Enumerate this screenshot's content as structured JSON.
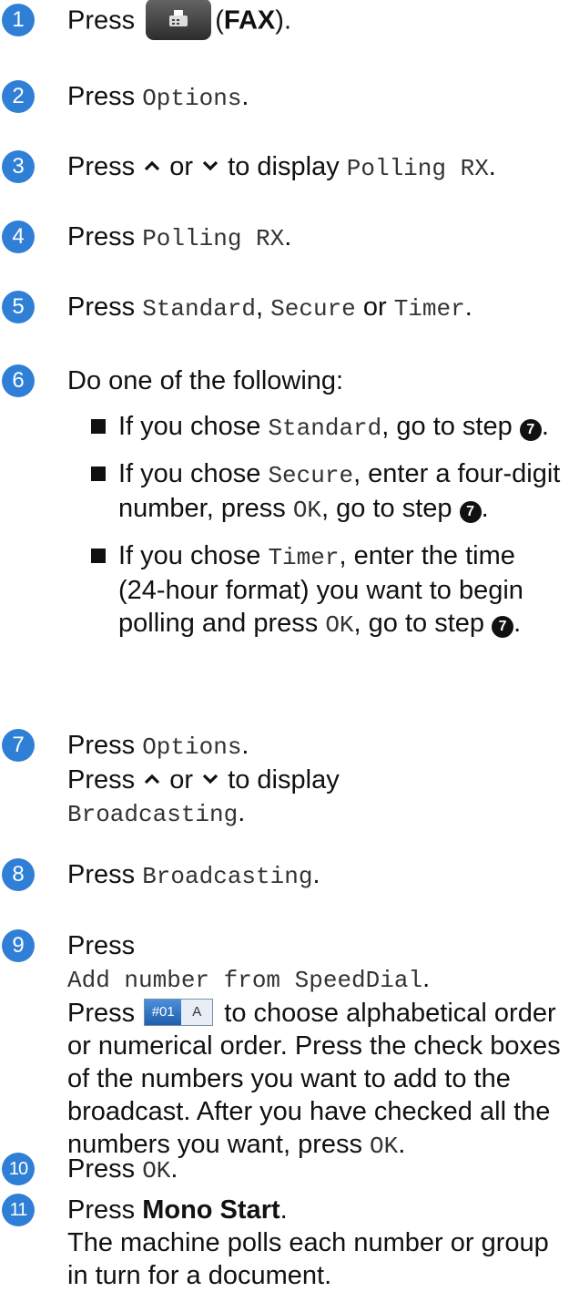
{
  "steps": [
    {
      "num": "1",
      "press": "Press",
      "btn_label": "FAX"
    },
    {
      "num": "2",
      "text": "Press",
      "opt": "Options"
    },
    {
      "num": "3",
      "press": "Press",
      "or": "or",
      "to_display": "to display",
      "opt": "Polling RX"
    },
    {
      "num": "4",
      "text": "Press",
      "opt": "Polling RX"
    },
    {
      "num": "5",
      "text": "Press",
      "opt1": "Standard",
      "opt2": "Secure",
      "or": "or",
      "opt3": "Timer"
    },
    {
      "num": "6",
      "text": "Do one of the following:",
      "bullets": [
        {
          "pre": "If you chose",
          "opt": "Standard",
          "post": ", go to step"
        },
        {
          "pre": "If you chose",
          "opt": "Secure",
          "post": ", enter a four-digit number, press",
          "ok": "OK",
          "post2": ", go to step"
        },
        {
          "pre": "If you chose",
          "opt": "Timer",
          "post": ", enter the time (24-hour format) you want to begin polling and press",
          "ok": "OK",
          "post2": ", go to step"
        }
      ],
      "ref": "7"
    },
    {
      "num": "7",
      "text": "Press",
      "opt": "Options",
      "press2": "Press",
      "or": "or",
      "to_display": "to display",
      "opt2": "Broadcasting"
    },
    {
      "num": "8",
      "text": "Press",
      "opt": "Broadcasting"
    },
    {
      "num": "9",
      "text": "Press",
      "opt": "Add number from SpeedDial",
      "press2": "Press",
      "btn_left": "#01",
      "btn_right": "A",
      "rest": "to choose alphabetical order or numerical order. Press the check boxes of the numbers you want to add to the broadcast. After you have checked all the numbers you want, press",
      "ok": "OK"
    },
    {
      "num": "10",
      "text": "Press",
      "ok": "OK"
    },
    {
      "num": "11",
      "text": "Press",
      "key": "Mono Start",
      "desc": "The machine polls each number or group in turn for a document."
    }
  ]
}
